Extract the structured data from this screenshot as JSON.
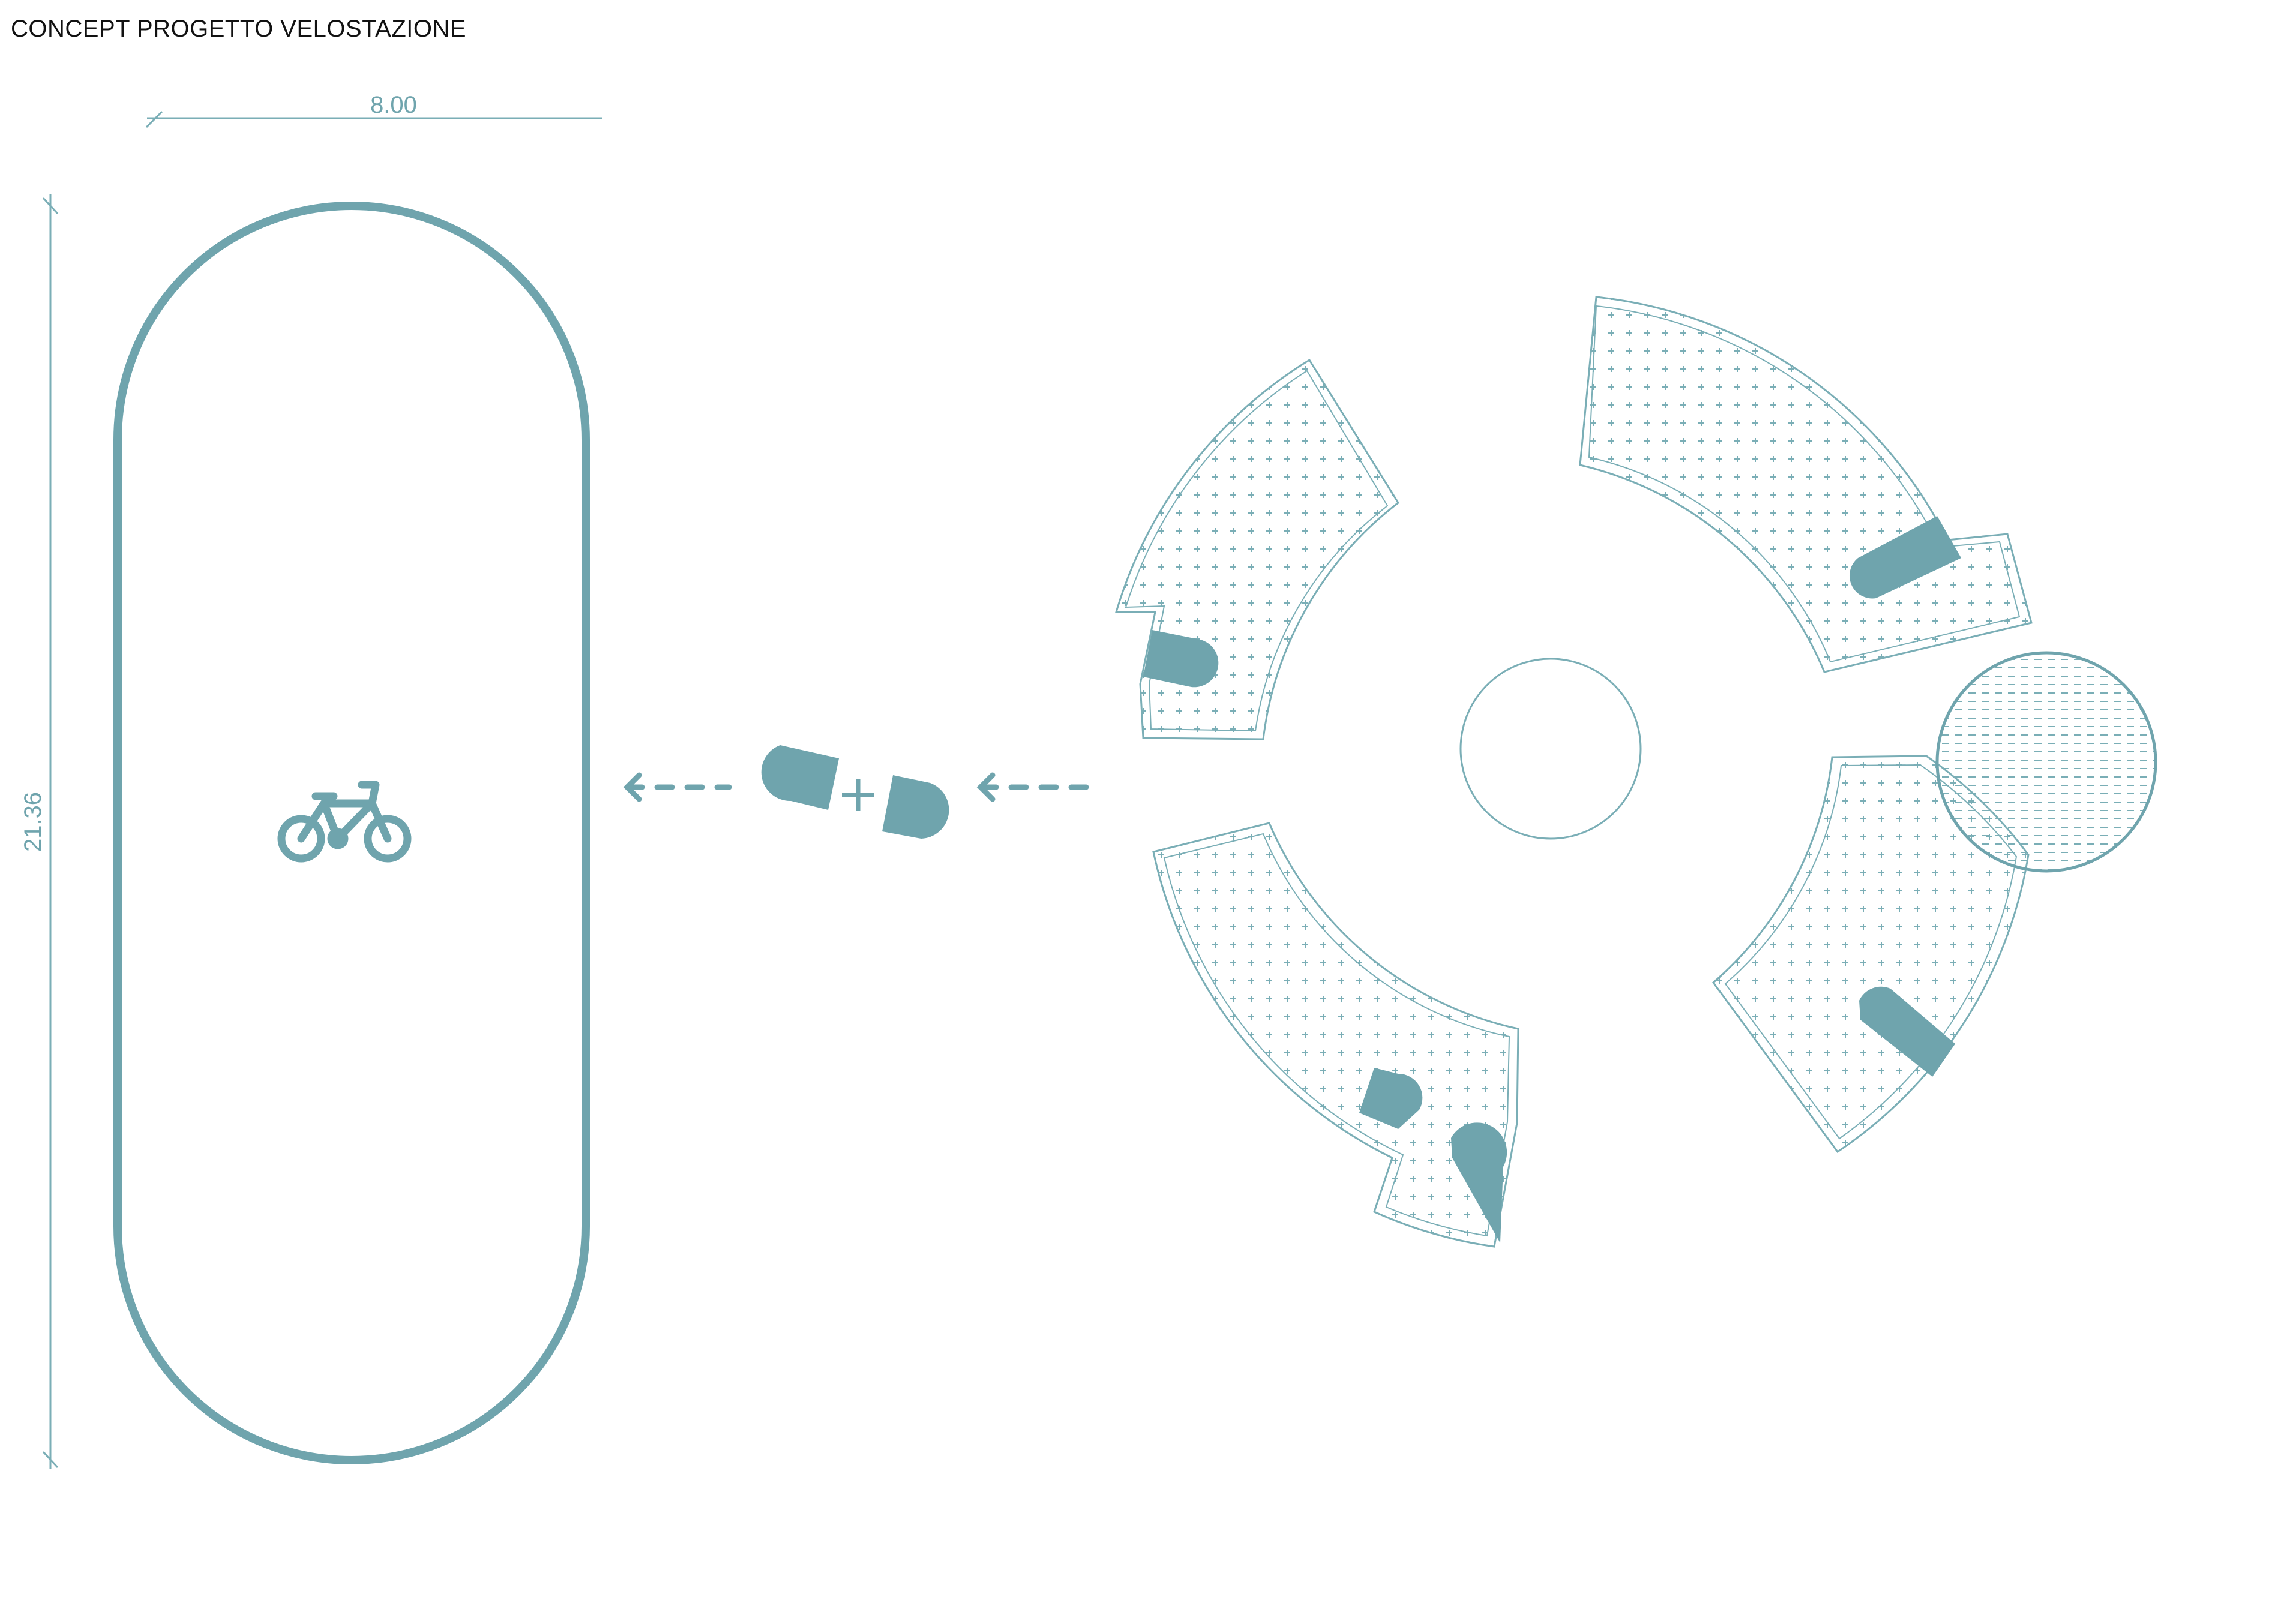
{
  "title": "CONCEPT PROGETTO VELOSTAZIONE",
  "dimensions": {
    "width_label": "8.00",
    "height_label": "21.36"
  },
  "colors": {
    "teal": "#6fa4ad",
    "teal_line": "#7aaeb6",
    "text": "#111111"
  },
  "icons": {
    "bicycle": "bicycle-icon",
    "arrow": "dashed-arrow-left-icon",
    "plus": "plus-icon"
  }
}
